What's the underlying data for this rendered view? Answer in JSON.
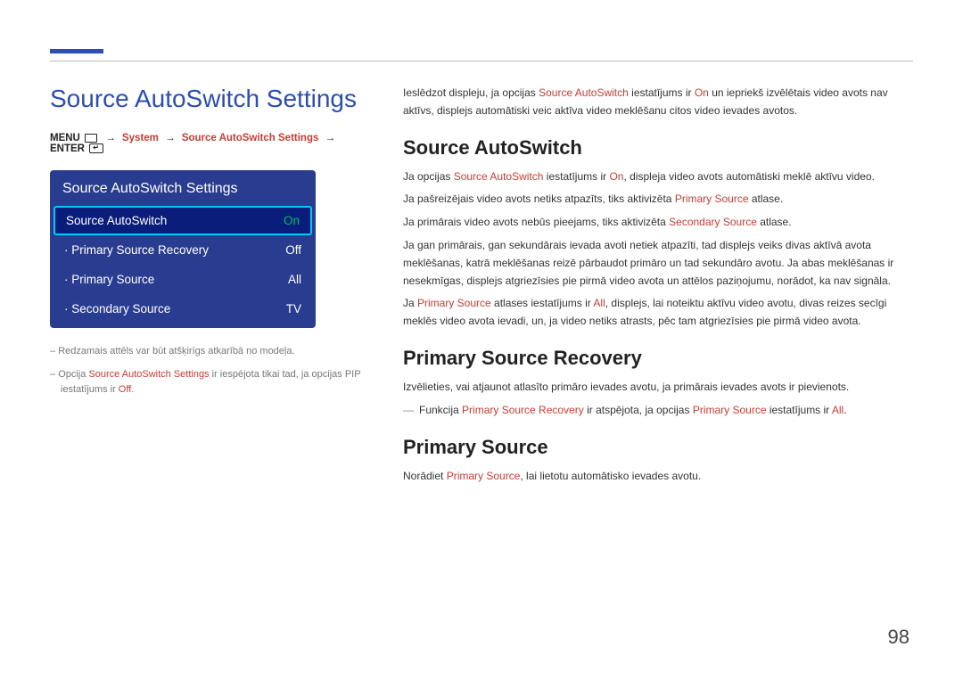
{
  "page_number": "98",
  "left": {
    "title": "Source AutoSwitch Settings",
    "breadcrumb": {
      "menu": "MENU",
      "path1": "System",
      "path2": "Source AutoSwitch Settings",
      "enter": "ENTER"
    },
    "panel": {
      "title": "Source AutoSwitch Settings",
      "rows": [
        {
          "label": "Source AutoSwitch",
          "value": "On",
          "selected": true
        },
        {
          "label": "· Primary Source Recovery",
          "value": "Off",
          "selected": false
        },
        {
          "label": "· Primary Source",
          "value": "All",
          "selected": false
        },
        {
          "label": "· Secondary Source",
          "value": "TV",
          "selected": false
        }
      ]
    },
    "footnotes": {
      "f1": "Redzamais attēls var būt atšķirīgs atkarībā no modeļa.",
      "f2_pre": "Opcija ",
      "f2_hl1": "Source AutoSwitch Settings",
      "f2_mid": " ir iespējota tikai tad, ja opcijas PIP iestatījums ir ",
      "f2_hl2": "Off",
      "f2_end": "."
    }
  },
  "right": {
    "intro_pre": "Ieslēdzot displeju, ja opcijas ",
    "intro_hl1": "Source AutoSwitch",
    "intro_mid": " iestatījums ir ",
    "intro_hl2": "On",
    "intro_end": " un iepriekš izvēlētais video avots nav aktīvs, displejs automātiski veic aktīva video meklēšanu citos video ievades avotos.",
    "h_autoswitch": "Source AutoSwitch",
    "as_p1_pre": "Ja opcijas ",
    "as_p1_hl1": "Source AutoSwitch",
    "as_p1_mid": " iestatījums ir ",
    "as_p1_hl2": "On",
    "as_p1_end": ", displeja video avots automātiski meklē aktīvu video.",
    "as_p2_pre": "Ja pašreizējais video avots netiks atpazīts, tiks aktivizēta ",
    "as_p2_hl": "Primary Source",
    "as_p2_end": " atlase.",
    "as_p3_pre": "Ja primārais video avots nebūs pieejams, tiks aktivizēta ",
    "as_p3_hl": "Secondary Source",
    "as_p3_end": " atlase.",
    "as_p4": "Ja gan primārais, gan sekundārais ievada avoti netiek atpazīti, tad displejs veiks divas aktīvā avota meklēšanas, katrā meklēšanas reizē pārbaudot primāro un tad sekundāro avotu. Ja abas meklēšanas ir nesekmīgas, displejs atgriezīsies pie pirmā video avota un attēlos paziņojumu, norādot, ka nav signāla.",
    "as_p5_pre": "Ja ",
    "as_p5_hl1": "Primary Source",
    "as_p5_mid1": " atlases iestatījums ir ",
    "as_p5_hl2": "All",
    "as_p5_end": ", displejs, lai noteiktu aktīvu video avotu, divas reizes secīgi meklēs video avota ievadi, un, ja video netiks atrasts, pēc tam atgriezīsies pie pirmā video avota.",
    "h_recovery": "Primary Source Recovery",
    "rec_p1": "Izvēlieties, vai atjaunot atlasīto primāro ievades avotu, ja primārais ievades avots ir pievienots.",
    "rec_note_pre": "Funkcija ",
    "rec_note_hl1": "Primary Source Recovery",
    "rec_note_mid": " ir atspējota, ja opcijas ",
    "rec_note_hl2": "Primary Source",
    "rec_note_mid2": " iestatījums ir ",
    "rec_note_hl3": "All",
    "rec_note_end": ".",
    "h_primary": "Primary Source",
    "pri_p1_pre": "Norādiet ",
    "pri_p1_hl": "Primary Source",
    "pri_p1_end": ", lai lietotu automātisko ievades avotu."
  }
}
